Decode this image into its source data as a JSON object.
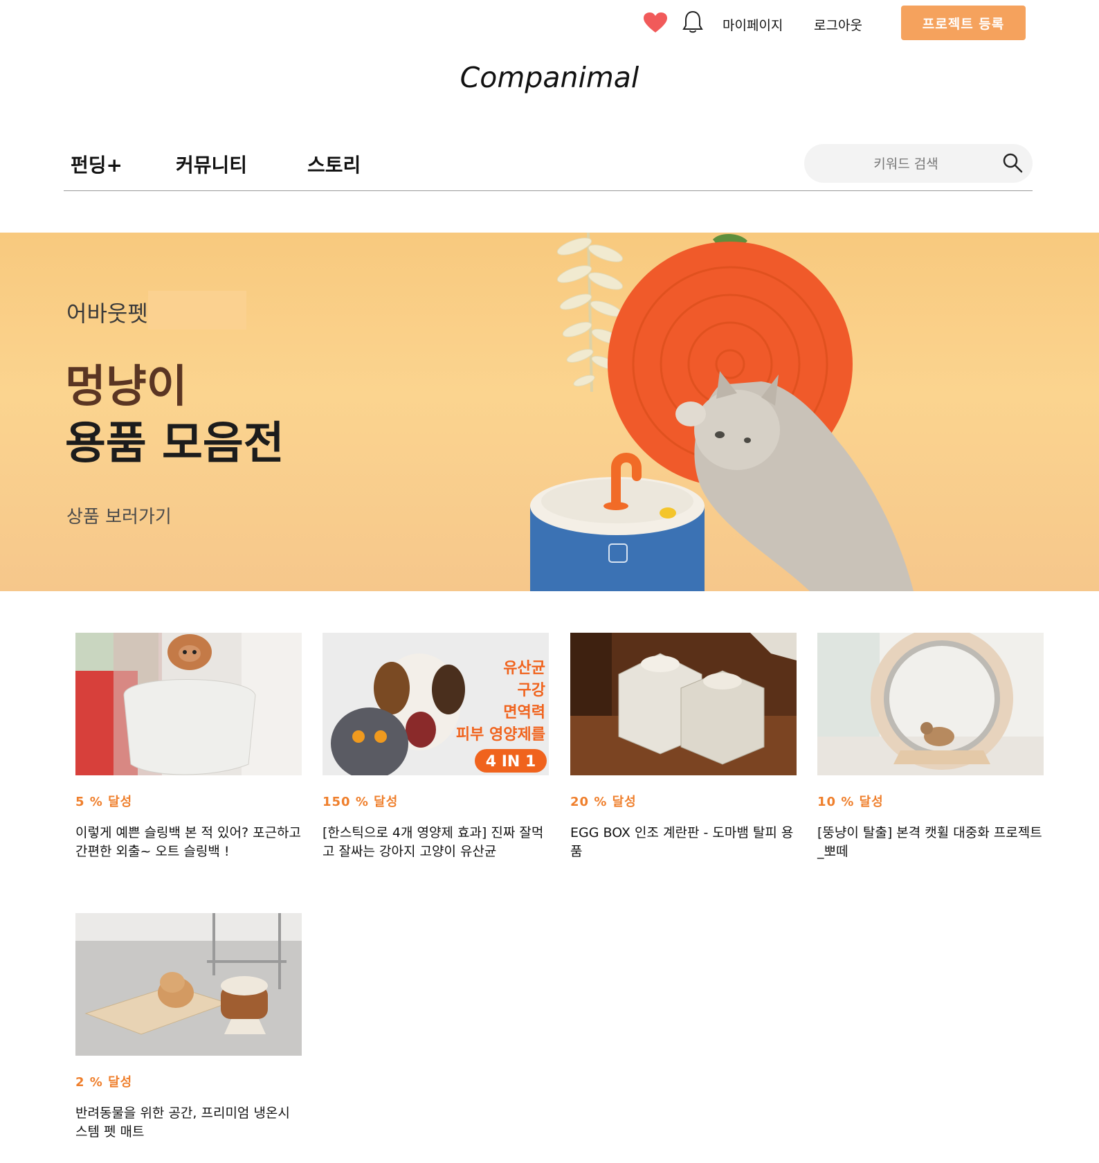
{
  "header": {
    "mypage": "마이페이지",
    "logout": "로그아웃",
    "project_button": "프로젝트 등록"
  },
  "logo": "Companimal",
  "nav": {
    "items": [
      {
        "label": "펀딩+"
      },
      {
        "label": "커뮤니티"
      },
      {
        "label": "스토리"
      }
    ]
  },
  "search": {
    "placeholder": "키워드 검색"
  },
  "banner": {
    "brand": "어바웃펫",
    "title_line1": "멍냥이",
    "title_line2": "용품 모음전",
    "link": "상품 보러가기"
  },
  "projects": [
    {
      "rate": "5 % 달성",
      "title": "이렇게 예쁜 슬링백 본 적 있어? 포근하고 간편한 외출~ 오트 슬링백 !"
    },
    {
      "rate": "150 % 달성",
      "title": "[한스틱으로 4개 영양제 효과] 진짜 잘먹고 잘싸는 강아지 고양이 유산균",
      "image_text": [
        "유산균",
        "구강",
        "면역력",
        "피부 영양제를",
        "4 IN 1"
      ]
    },
    {
      "rate": "20 % 달성",
      "title": "EGG BOX 인조 계란판 - 도마뱀 탈피 용품"
    },
    {
      "rate": "10 % 달성",
      "title": "[뚱냥이 탈출] 본격 캣휠 대중화 프로젝트 _뽀떼"
    },
    {
      "rate": "2 % 달성",
      "title": "반려동물을 위한 공간, 프리미엄 냉온시스템 펫 매트"
    }
  ],
  "colors": {
    "accent": "#f5a25d",
    "rate": "#ef7f2c",
    "heart": "#f15a5a",
    "banner_bg": "#f9cd86"
  },
  "icons": [
    "heart-icon",
    "bell-icon",
    "search-icon"
  ]
}
